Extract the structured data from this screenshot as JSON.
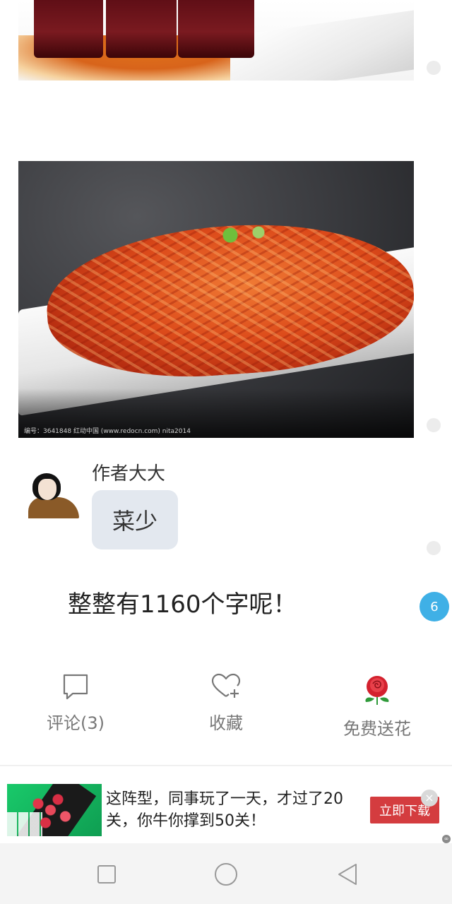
{
  "images": {
    "top_image": "braised-pork-photo",
    "main_image": "stir-fried-eel-noodles-photo",
    "watermark": "编号：3641848   红动中国 (www.redocn.com)   nita2014"
  },
  "post": {
    "author_name": "作者大大",
    "bubble_text": "菜少",
    "body_text": "整整有1160个字呢！"
  },
  "badge": {
    "count": "6",
    "color": "#3fb0e6"
  },
  "actions": {
    "comment_label": "评论(3)",
    "favorite_label": "收藏",
    "flower_label": "免费送花"
  },
  "ad": {
    "text": "这阵型，同事玩了一天，才过了20关，你牛你撑到50关！",
    "button_label": "立即下载",
    "close_symbol": "×",
    "button_color": "#d43c3f"
  },
  "icons": {
    "comment": "comment-bubble-icon",
    "favorite": "heart-plus-icon",
    "flower": "rose-icon",
    "nav_recent": "square-icon",
    "nav_home": "circle-icon",
    "nav_back": "triangle-back-icon"
  }
}
